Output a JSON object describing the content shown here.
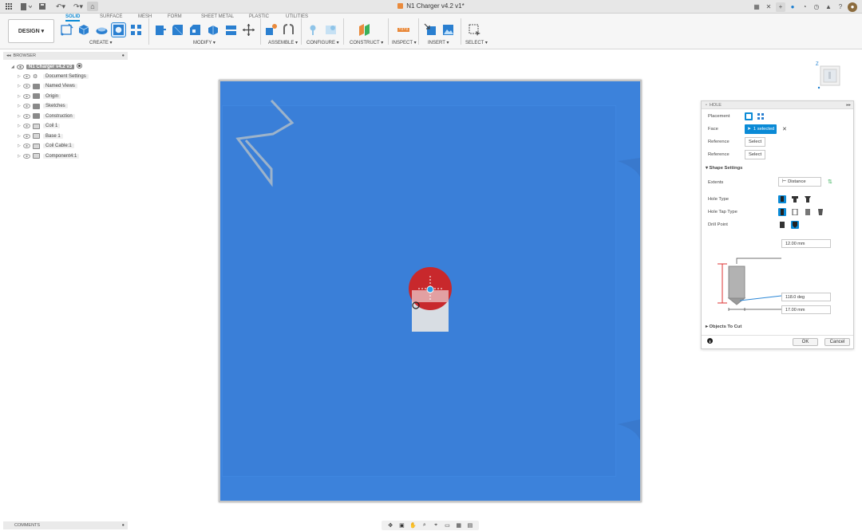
{
  "app": {
    "title": "N1 Charger v4.2 v1*"
  },
  "workspace": {
    "mode_label": "DESIGN ▾"
  },
  "toolbar": {
    "tabs": [
      "SOLID",
      "SURFACE",
      "MESH",
      "FORM",
      "SHEET METAL",
      "PLASTIC",
      "UTILITIES"
    ],
    "active_tab": "SOLID",
    "groups": [
      "CREATE ▾",
      "MODIFY ▾",
      "ASSEMBLE ▾",
      "CONFIGURE ▾",
      "CONSTRUCT ▾",
      "INSPECT ▾",
      "INSERT ▾",
      "SELECT ▾"
    ]
  },
  "browser": {
    "header": "BROWSER",
    "root_label": "N1 Charger v4.2 v3",
    "items": [
      {
        "label": "Document Settings",
        "icon": "gear-icon"
      },
      {
        "label": "Named Views",
        "icon": "folder-icon"
      },
      {
        "label": "Origin",
        "icon": "folder-icon"
      },
      {
        "label": "Sketches",
        "icon": "folder-icon"
      },
      {
        "label": "Construction",
        "icon": "folder-icon"
      },
      {
        "label": "Coil 1",
        "icon": "component-icon"
      },
      {
        "label": "Base 1",
        "icon": "component-icon"
      },
      {
        "label": "Coil Cable:1",
        "icon": "component-icon"
      },
      {
        "label": "Component4:1",
        "icon": "component-icon"
      }
    ]
  },
  "hole_panel": {
    "title": "HOLE",
    "placement_label": "Placement",
    "face_label": "Face",
    "face_value": "1 selected",
    "reference1_label": "Reference",
    "reference1_value": "Select",
    "reference2_label": "Reference",
    "reference2_value": "Select",
    "shape_settings_label": "Shape Settings",
    "extents_label": "Extents",
    "extents_value": "Distance",
    "hole_type_label": "Hole Type",
    "hole_tap_type_label": "Hole Tap Type",
    "drill_point_label": "Drill Point",
    "diameter_value": "12.00 mm",
    "angle_value": "118.0 deg",
    "depth_value": "17.00 mm",
    "objects_to_cut_label": "Objects To Cut",
    "ok_label": "OK",
    "cancel_label": "Cancel"
  },
  "comments": {
    "label": "COMMENTS"
  },
  "colors": {
    "accent": "#0a8ad6",
    "canvas_blue": "#3a7fd8",
    "hole_red": "#c8282c"
  }
}
